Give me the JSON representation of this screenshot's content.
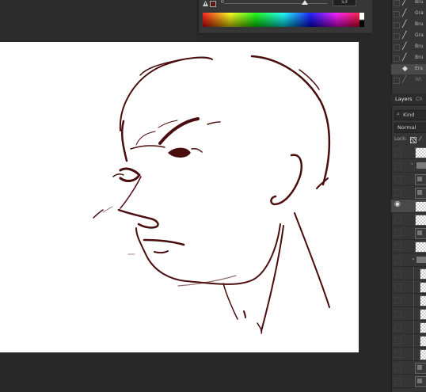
{
  "color_panel": {
    "slider_left": "0",
    "slider_value": "53",
    "slider_fraction": 0.75,
    "fg_color": "#5a1a1a"
  },
  "brushes": [
    {
      "label": "Bru",
      "icon": "brush-icon",
      "dim": false,
      "selected": false
    },
    {
      "label": "Gra",
      "icon": "brush-icon",
      "dim": false,
      "selected": false
    },
    {
      "label": "Bru",
      "icon": "brush-icon",
      "dim": false,
      "selected": false
    },
    {
      "label": "Gra",
      "icon": "brush-icon",
      "dim": false,
      "selected": false
    },
    {
      "label": "Bru",
      "icon": "brush-icon",
      "dim": false,
      "selected": false
    },
    {
      "label": "Bru",
      "icon": "brush-icon",
      "dim": false,
      "selected": false
    },
    {
      "label": "Era",
      "icon": "eraser-icon",
      "dim": false,
      "selected": true
    },
    {
      "label": "Wt",
      "icon": "brush-icon",
      "dim": true,
      "selected": false
    }
  ],
  "layers_panel": {
    "tab_layers": "Layers",
    "tab_channels": "Ch",
    "filter_label": "Kind",
    "blend_mode": "Normal",
    "lock_label": "Lock:"
  },
  "layers": [
    {
      "type": "thumb",
      "visible": false
    },
    {
      "type": "folder",
      "visible": false
    },
    {
      "type": "dark",
      "visible": false
    },
    {
      "type": "dark",
      "visible": false
    },
    {
      "type": "thumb",
      "visible": true,
      "selected": true
    },
    {
      "type": "thumb",
      "visible": false
    },
    {
      "type": "dark",
      "visible": false
    },
    {
      "type": "thumb",
      "visible": false
    },
    {
      "type": "folder-open",
      "visible": false
    },
    {
      "type": "thumb-indent",
      "visible": false
    },
    {
      "type": "thumb-indent",
      "visible": false
    },
    {
      "type": "thumb-indent",
      "visible": false
    },
    {
      "type": "thumb-indent",
      "visible": false
    },
    {
      "type": "thumb-indent",
      "visible": false
    },
    {
      "type": "thumb-indent",
      "visible": false
    },
    {
      "type": "thumb-indent",
      "visible": false
    },
    {
      "type": "dark",
      "visible": false
    },
    {
      "type": "dark",
      "visible": false
    }
  ],
  "sketch_color": "#4a0d0d"
}
